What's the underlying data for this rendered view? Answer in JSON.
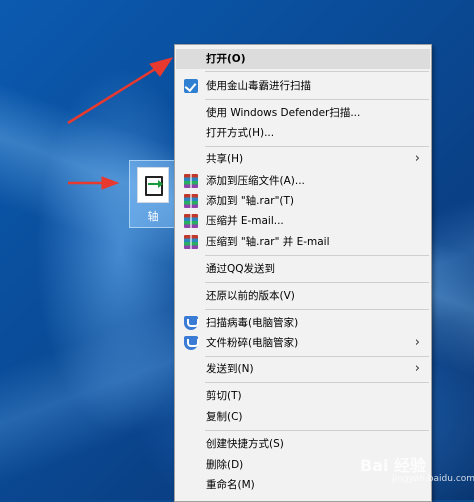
{
  "desktop": {
    "file_label": "轴"
  },
  "context_menu": {
    "items": [
      {
        "label": "打开(O)"
      },
      {
        "label": "使用金山毒霸进行扫描",
        "icon": "jinshan-icon"
      },
      {
        "label": "使用 Windows Defender扫描..."
      },
      {
        "label": "打开方式(H)..."
      },
      {
        "label": "共享(H)",
        "submenu": true
      },
      {
        "label": "添加到压缩文件(A)...",
        "icon": "winrar-icon"
      },
      {
        "label": "添加到 \"轴.rar\"(T)",
        "icon": "winrar-icon"
      },
      {
        "label": "压缩并 E-mail...",
        "icon": "winrar-icon"
      },
      {
        "label": "压缩到 \"轴.rar\" 并 E-mail",
        "icon": "winrar-icon"
      },
      {
        "label": "通过QQ发送到"
      },
      {
        "label": "还原以前的版本(V)"
      },
      {
        "label": "扫描病毒(电脑管家)",
        "icon": "shield-icon"
      },
      {
        "label": "文件粉碎(电脑管家)",
        "icon": "shield-icon",
        "submenu": true
      },
      {
        "label": "发送到(N)",
        "submenu": true
      },
      {
        "label": "剪切(T)"
      },
      {
        "label": "复制(C)"
      },
      {
        "label": "创建快捷方式(S)"
      },
      {
        "label": "删除(D)"
      },
      {
        "label": "重命名(M)"
      }
    ],
    "submenu_glyph": "›"
  },
  "watermark": {
    "text": "Bai 经验",
    "sub": "jingyan.baidu.com"
  },
  "colors": {
    "annotation_arrow": "#e8392f",
    "menu_bg": "#f2f2f2",
    "hover_bg": "#dcdcdc"
  }
}
